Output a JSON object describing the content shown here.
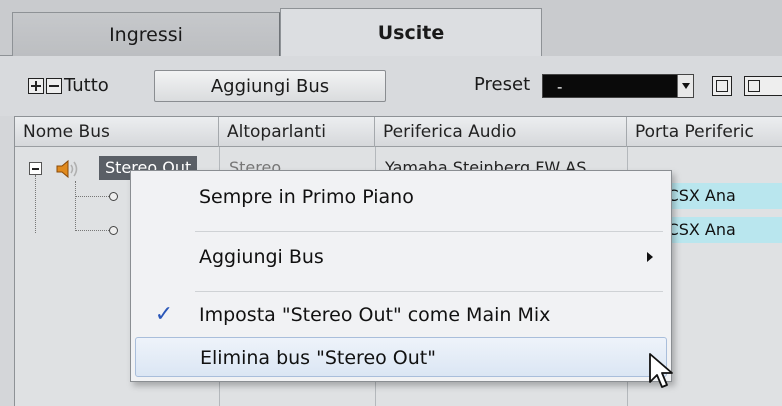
{
  "tabs": [
    {
      "label": "Ingressi",
      "active": false
    },
    {
      "label": "Uscite",
      "active": true
    }
  ],
  "toolbar": {
    "tutto_label": "Tutto",
    "add_bus_label": "Aggiungi Bus",
    "preset_label": "Preset",
    "preset_value": "-"
  },
  "table": {
    "headers": [
      "Nome Bus",
      "Altoparlanti",
      "Periferica Audio",
      "Porta Periferic"
    ],
    "rows": [
      {
        "name": "Stereo Out",
        "speakers": "Stereo",
        "device": "Yamaha Steinberg FW AS",
        "port": ""
      },
      {
        "name": "",
        "speakers": "",
        "device": "",
        "port": "316CSX Ana"
      },
      {
        "name": "",
        "speakers": "",
        "device": "",
        "port": "316CSX Ana"
      }
    ]
  },
  "context_menu": {
    "items": [
      {
        "label": "Sempre in Primo Piano",
        "checked": false,
        "submenu": false
      },
      {
        "label": "Aggiungi Bus",
        "checked": false,
        "submenu": true
      },
      {
        "label": "Imposta \"Stereo Out\" come Main Mix",
        "checked": true,
        "submenu": false
      },
      {
        "label": "Elimina bus \"Stereo Out\"",
        "checked": false,
        "submenu": false,
        "hovered": true
      }
    ],
    "check_glyph": "✓"
  },
  "colors": {
    "selection_bg": "#5a5f66",
    "highlight_cell": "#b9e6ee",
    "menu_hover": "#dbe6f4",
    "check_color": "#2a57b8",
    "speaker_color": "#e08a1e"
  }
}
